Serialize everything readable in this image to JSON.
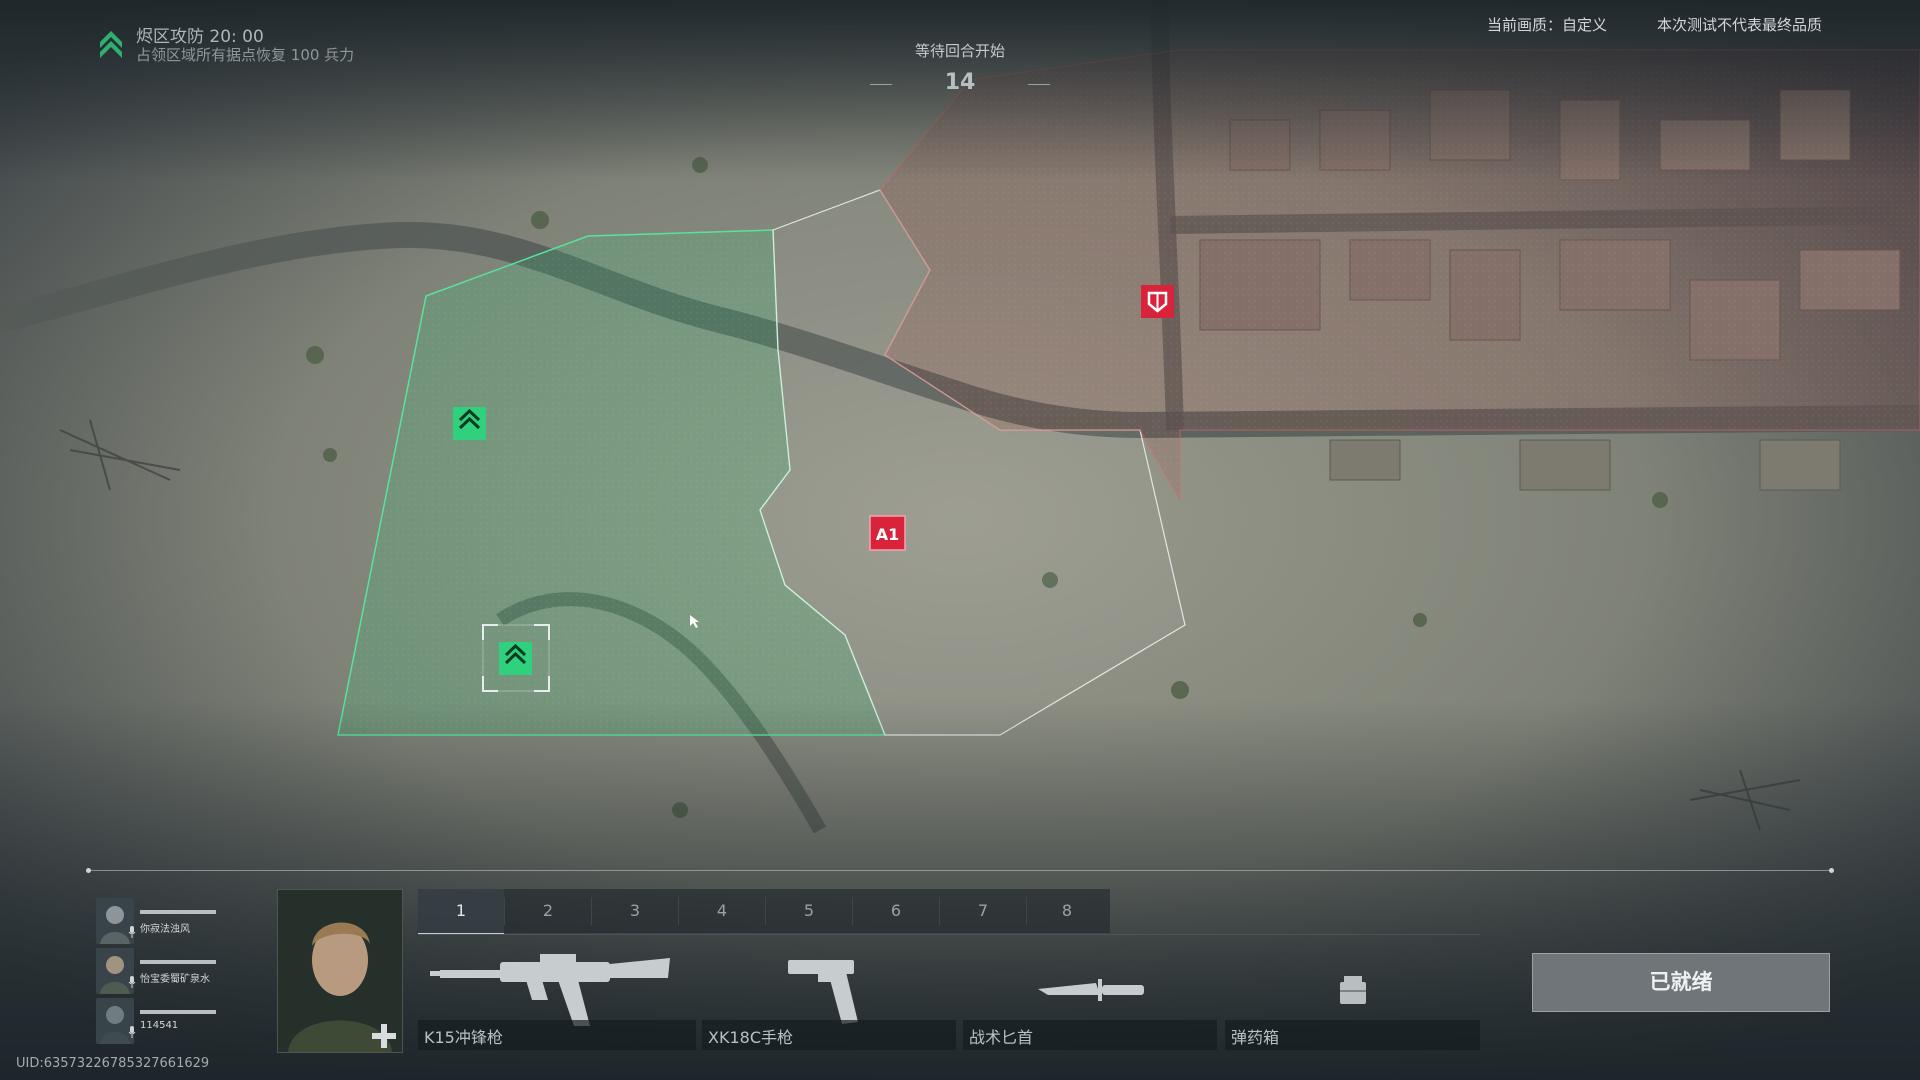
{
  "mode": {
    "title": "烬区攻防 20: 00",
    "description": "占领区域所有据点恢复 100 兵力",
    "icon": "chevron-up-icon",
    "accent": "#2fd17d"
  },
  "round": {
    "status": "等待回合开始",
    "countdown": "14"
  },
  "settings": {
    "quality": "当前画质：自定义",
    "disclaimer": "本次测试不代表最终品质"
  },
  "map": {
    "objectives": [
      {
        "label": "A1",
        "team": "enemy",
        "color": "#d8233b"
      }
    ],
    "friendly_color": "#2fd17d",
    "enemy_color": "#d8233b"
  },
  "squad": [
    {
      "name": "你寂法浊风"
    },
    {
      "name": "怡宝委蜀矿泉水"
    },
    {
      "name": "114541"
    }
  ],
  "loadout": {
    "tabs": [
      "1",
      "2",
      "3",
      "4",
      "5",
      "6",
      "7",
      "8"
    ],
    "active_tab": "1",
    "slots": [
      {
        "label": "K15冲锋枪",
        "icon": "smg-icon"
      },
      {
        "label": "XK18C手枪",
        "icon": "pistol-icon"
      },
      {
        "label": "战术匕首",
        "icon": "knife-icon"
      },
      {
        "label": "弹药箱",
        "icon": "ammo-box-icon"
      }
    ]
  },
  "ready_button": "已就绪",
  "uid": "UID:635732267853276616​29"
}
